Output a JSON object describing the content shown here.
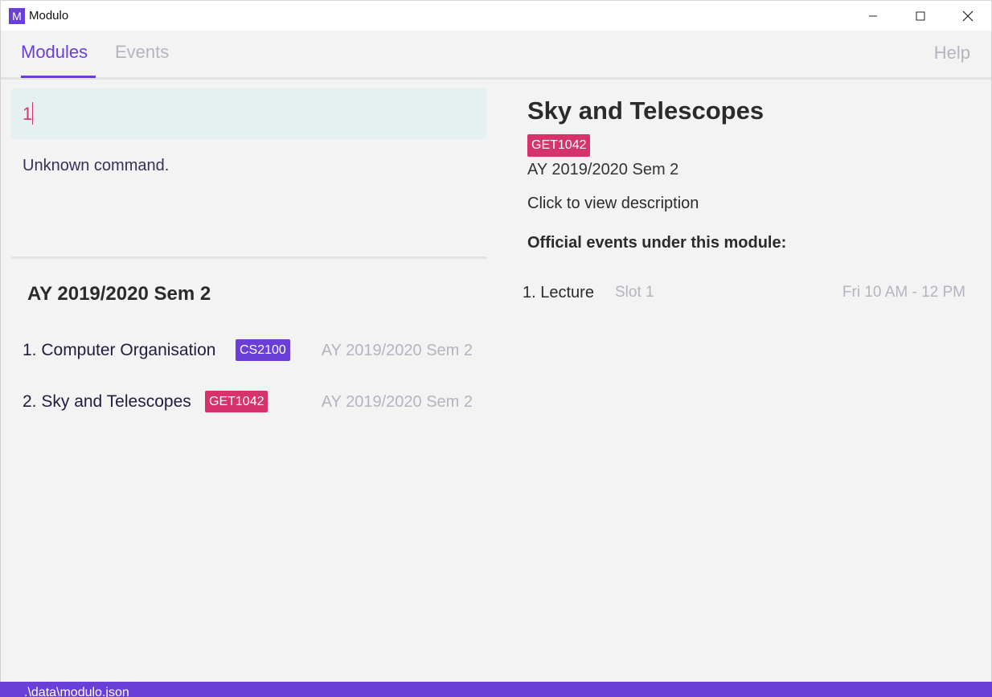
{
  "window": {
    "app_icon_letter": "M",
    "title": "Modulo"
  },
  "tabs": {
    "items": [
      {
        "label": "Modules",
        "active": true
      },
      {
        "label": "Events",
        "active": false
      }
    ],
    "help_label": "Help"
  },
  "command": {
    "value": "1",
    "result": "Unknown command."
  },
  "module_list": {
    "heading": "AY 2019/2020 Sem 2",
    "items": [
      {
        "name": "1. Computer Organisation",
        "code": "CS2100",
        "code_color": "#6a3fd9",
        "semester": "AY 2019/2020 Sem 2"
      },
      {
        "name": "2. Sky and Telescopes",
        "code": "GET1042",
        "code_color": "#d6336c",
        "semester": "AY 2019/2020 Sem 2"
      }
    ]
  },
  "detail": {
    "title": "Sky and Telescopes",
    "code": "GET1042",
    "semester": "AY 2019/2020 Sem 2",
    "description_link": "Click to view description",
    "events_heading": "Official events under this module:",
    "events": [
      {
        "name": "1. Lecture",
        "slot": "Slot 1",
        "time": "Fri 10 AM - 12 PM"
      }
    ]
  },
  "status_bar": {
    "path": ".\\data\\modulo.json"
  },
  "colors": {
    "accent": "#6a3fd9",
    "tag_pink": "#d6336c",
    "command_bg": "#e5f0f0"
  }
}
